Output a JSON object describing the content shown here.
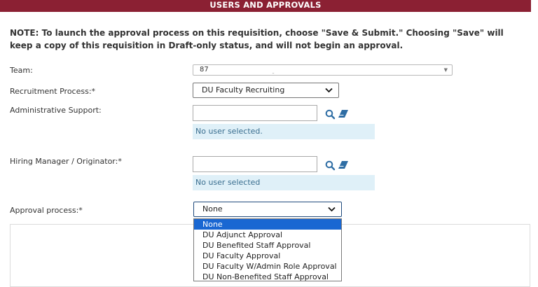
{
  "banner": {
    "title": "USERS AND APPROVALS"
  },
  "note": "NOTE: To launch the approval process on this requisition, choose \"Save & Submit.\" Choosing \"Save\" will keep a copy of this requisition in Draft-only status, and will not begin an approval.",
  "team": {
    "label": "Team:",
    "value": "87"
  },
  "recruitment": {
    "label": "Recruitment Process:*",
    "value": "DU Faculty Recruiting"
  },
  "admin_support": {
    "label": "Administrative Support:",
    "status": "No user selected."
  },
  "hiring_manager": {
    "label": "Hiring Manager / Originator:*",
    "status": "No user selected"
  },
  "approval": {
    "label": "Approval process:*",
    "value": "None",
    "options": [
      "None",
      "DU Adjunct Approval",
      "DU Benefited Staff Approval",
      "DU Faculty Approval",
      "DU Faculty W/Admin Role Approval",
      "DU Non-Benefited Staff Approval"
    ]
  },
  "icons": {
    "search": "search-icon",
    "clear": "eraser-icon"
  },
  "colors": {
    "banner": "#8b2033",
    "info_bg": "#dff0f8",
    "icon": "#2e6da4",
    "selected": "#1967d2"
  }
}
